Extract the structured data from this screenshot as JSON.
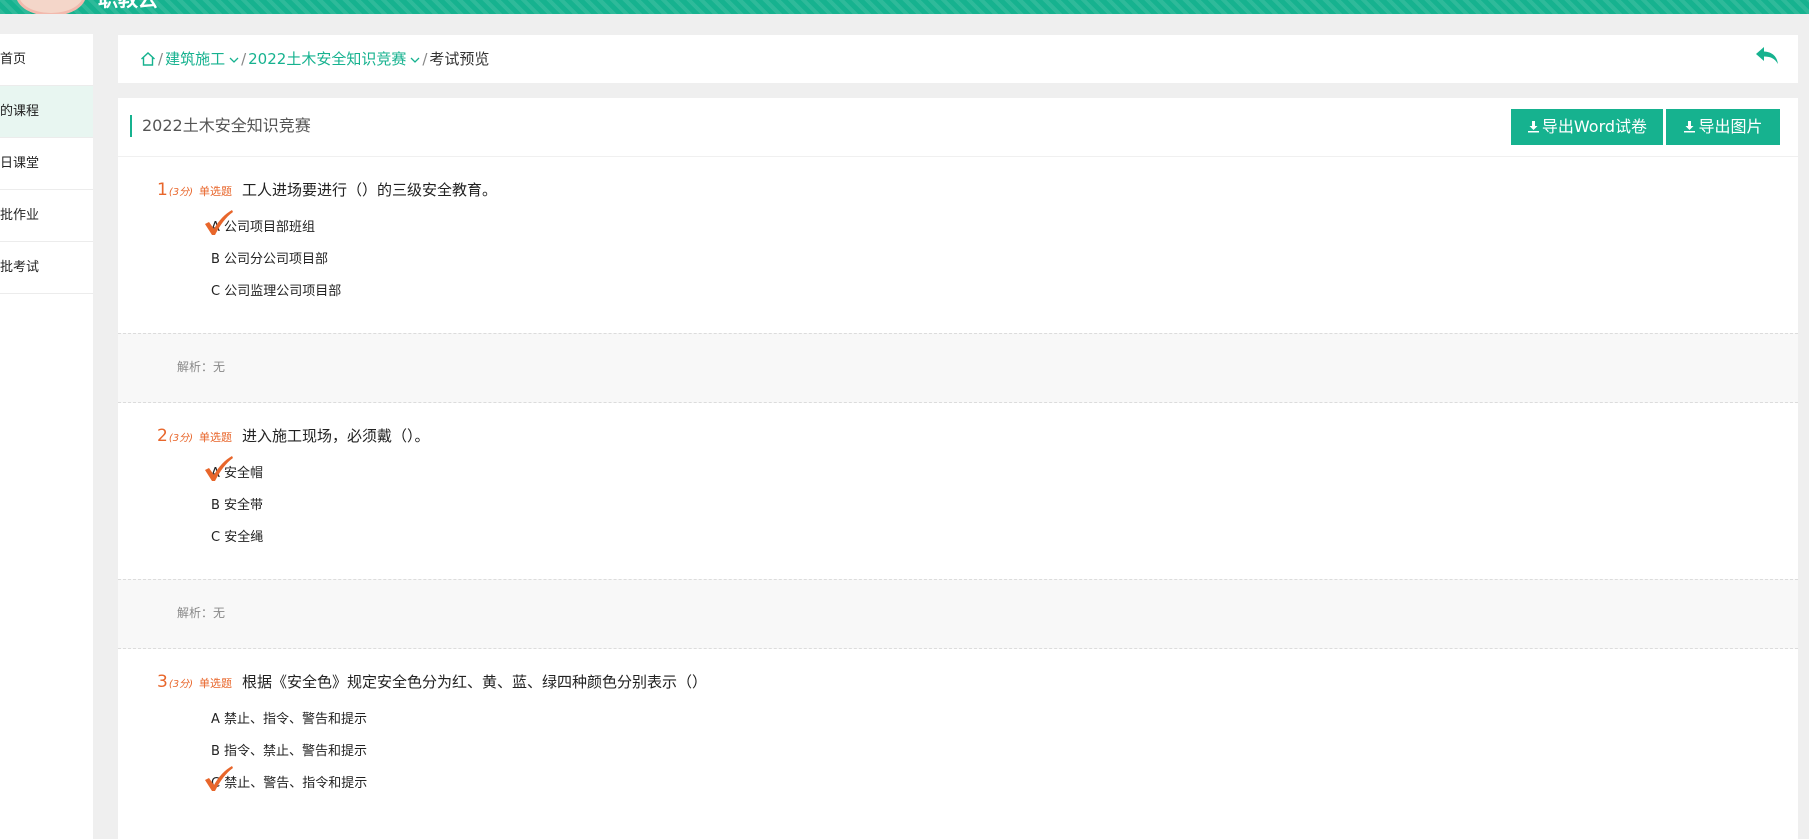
{
  "app": {
    "brand": "职教云"
  },
  "sidebar": {
    "items": [
      {
        "label": "首页"
      },
      {
        "label": "的课程"
      },
      {
        "label": "日课堂"
      },
      {
        "label": "批作业"
      },
      {
        "label": "批考试"
      }
    ]
  },
  "breadcrumb": {
    "items": [
      "建筑施工",
      "2022土木安全知识竞赛"
    ],
    "current": "考试预览"
  },
  "main": {
    "title": "2022土木安全知识竞赛",
    "export_word": "导出Word试卷",
    "export_image": "导出图片"
  },
  "questions": [
    {
      "num": "1",
      "score": "(3分)",
      "type": "单选题",
      "text": "工人进场要进行（）的三级安全教育。",
      "options": [
        "A 公司项目部班组",
        "B 公司分公司项目部",
        "C 公司监理公司项目部"
      ],
      "answer_index": 0,
      "analysis": "解析：无"
    },
    {
      "num": "2",
      "score": "(3分)",
      "type": "单选题",
      "text": "进入施工现场，必须戴（）。",
      "options": [
        "A 安全帽",
        "B 安全带",
        "C 安全绳"
      ],
      "answer_index": 0,
      "analysis": "解析：无"
    },
    {
      "num": "3",
      "score": "(3分)",
      "type": "单选题",
      "text": "根据《安全色》规定安全色分为红、黄、蓝、绿四种颜色分别表示（）",
      "options": [
        "A 禁止、指令、警告和提示",
        "B 指令、禁止、警告和提示",
        "C 禁止、警告、指令和提示"
      ],
      "answer_index": 2,
      "analysis": ""
    }
  ],
  "colors": {
    "accent": "#16b28f",
    "question_meta": "#e8662b",
    "check": "#e8662b"
  },
  "icons": {
    "home": "home-icon",
    "chevron": "chevron-down-icon",
    "back": "back-arrow-icon",
    "download": "download-icon",
    "check": "check-icon"
  }
}
